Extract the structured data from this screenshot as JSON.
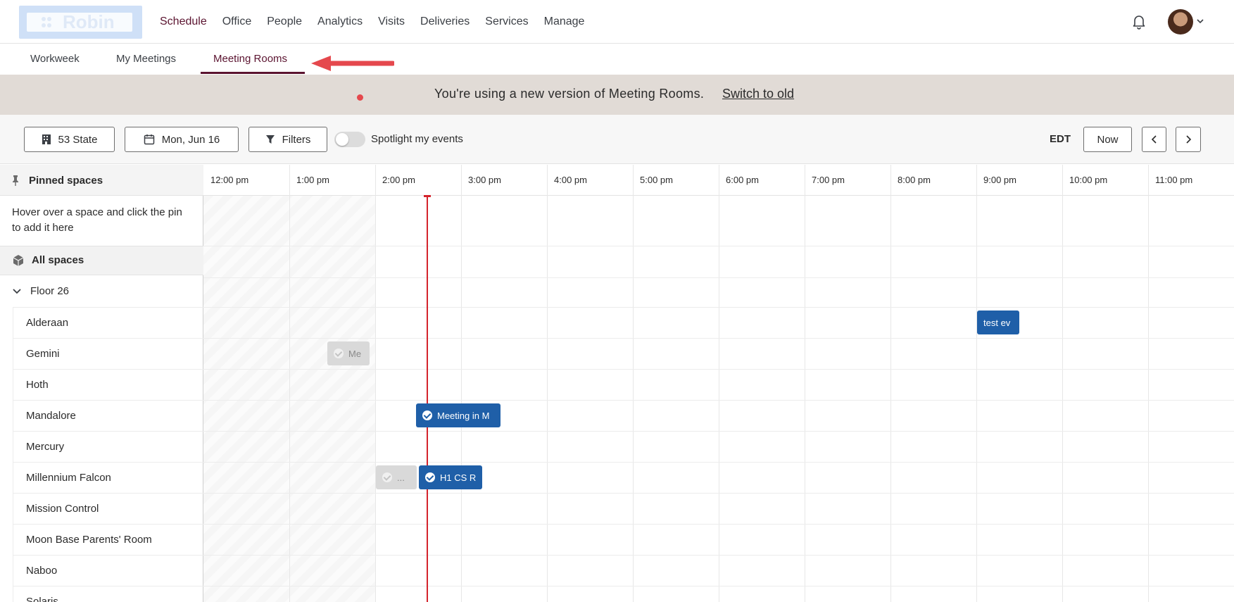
{
  "nav": {
    "logo_text": "Robin",
    "items": [
      "Schedule",
      "Office",
      "People",
      "Analytics",
      "Visits",
      "Deliveries",
      "Services",
      "Manage"
    ],
    "active": "Schedule"
  },
  "subtabs": {
    "items": [
      "Workweek",
      "My Meetings",
      "Meeting Rooms"
    ],
    "active": "Meeting Rooms"
  },
  "banner": {
    "message": "You're using a new version of Meeting Rooms.",
    "link": "Switch to old"
  },
  "toolbar": {
    "location": "53 State",
    "date": "Mon, Jun 16",
    "filters": "Filters",
    "spotlight_label": "Spotlight my events",
    "spotlight_on": false,
    "timezone": "EDT",
    "now_label": "Now"
  },
  "sidebar": {
    "pinned_label": "Pinned spaces",
    "pinned_hint": "Hover over a space and click the pin to add it here",
    "all_spaces_label": "All spaces",
    "floor_label": "Floor 26",
    "rooms": [
      "Alderaan",
      "Gemini",
      "Hoth",
      "Mandalore",
      "Mercury",
      "Millennium Falcon",
      "Mission Control",
      "Moon Base Parents' Room",
      "Naboo",
      "Solaris"
    ]
  },
  "timeline": {
    "hours": [
      "12:00 pm",
      "1:00 pm",
      "2:00 pm",
      "3:00 pm",
      "4:00 pm",
      "5:00 pm",
      "6:00 pm",
      "7:00 pm",
      "8:00 pm",
      "9:00 pm",
      "10:00 pm",
      "11:00 pm"
    ]
  },
  "events": [
    {
      "room": "Alderaan",
      "title": "test ev",
      "style": "blue",
      "icon": false
    },
    {
      "room": "Gemini",
      "title": "Me",
      "style": "grey",
      "icon": true
    },
    {
      "room": "Mandalore",
      "title": "Meeting in M",
      "style": "blue",
      "icon": true
    },
    {
      "room": "Millennium Falcon",
      "title": "...",
      "style": "grey",
      "icon": true
    },
    {
      "room": "Millennium Falcon",
      "title": "H1 CS R",
      "style": "blue",
      "icon": true
    }
  ],
  "colors": {
    "brand": "#5b1430",
    "event_blue": "#1f5fa8",
    "now_line": "#d4232c",
    "banner_bg": "#e1dbd6"
  }
}
